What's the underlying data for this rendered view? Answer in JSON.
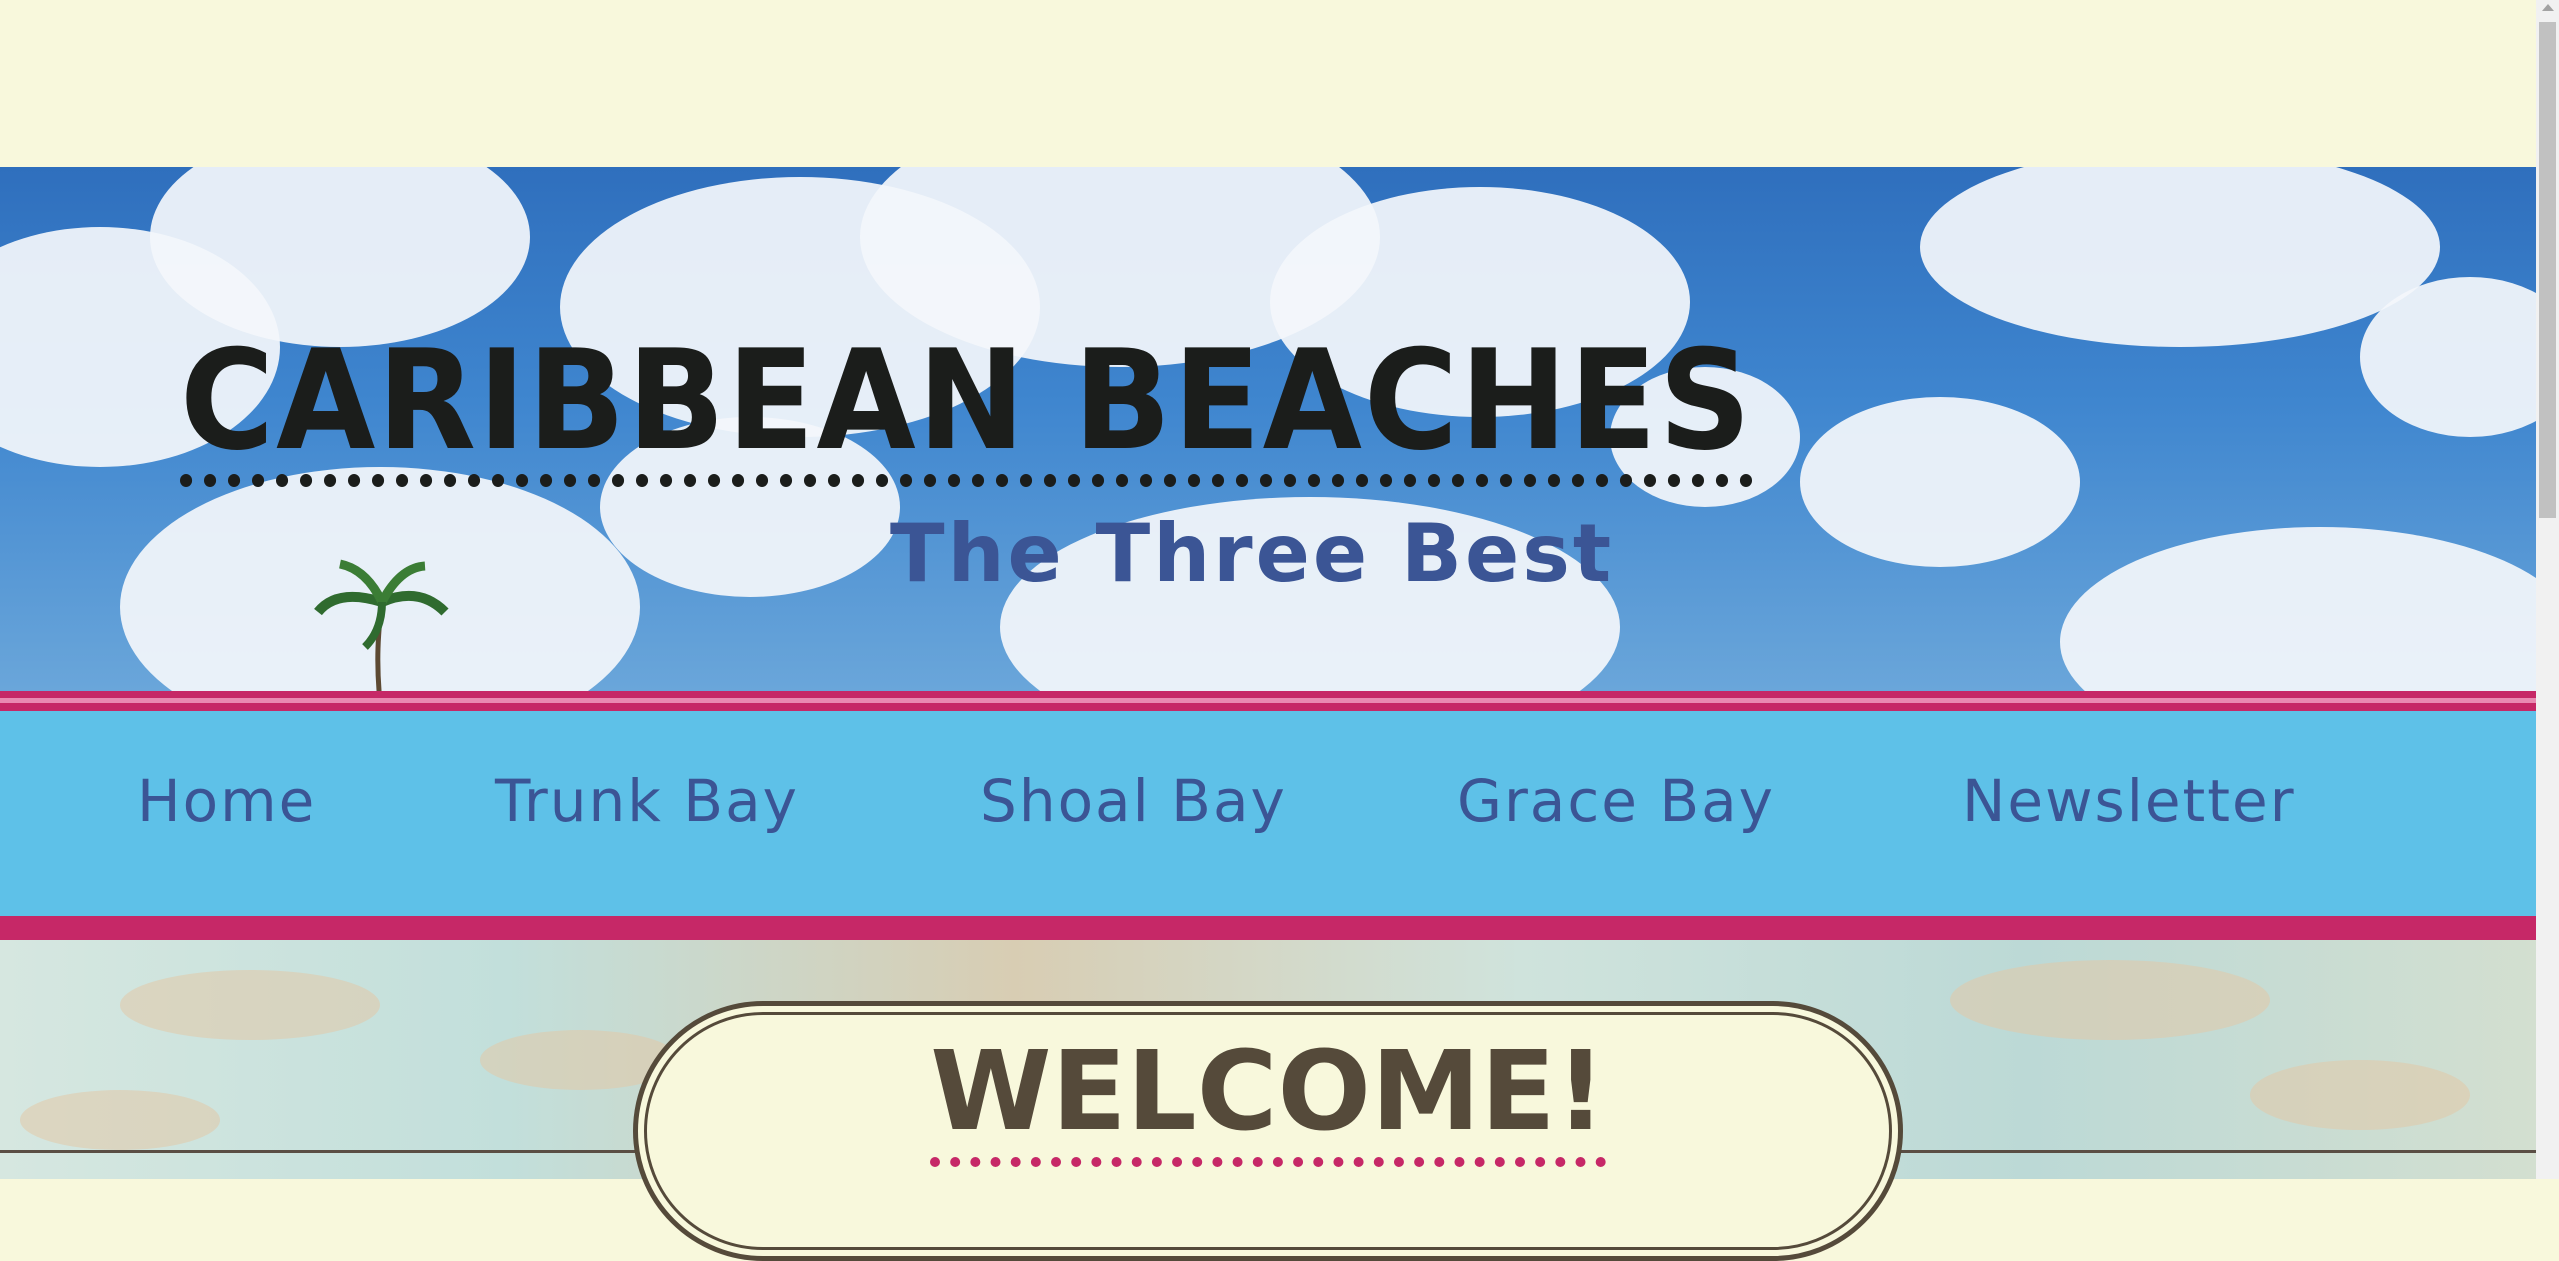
{
  "header": {
    "title": "Caribbean Beaches",
    "subtitle": "The Three Best"
  },
  "nav": {
    "items": [
      {
        "label": "Home"
      },
      {
        "label": "Trunk Bay"
      },
      {
        "label": "Shoal Bay"
      },
      {
        "label": "Grace Bay"
      },
      {
        "label": "Newsletter"
      }
    ]
  },
  "main": {
    "welcome": "Welcome!"
  },
  "colors": {
    "page_background": "#f8f8dc",
    "accent_pink": "#c62867",
    "nav_blue": "#5ec1e8",
    "text_navy": "#3b5595",
    "title_dark": "#1b1d1b",
    "welcome_brown": "#554a3a"
  }
}
